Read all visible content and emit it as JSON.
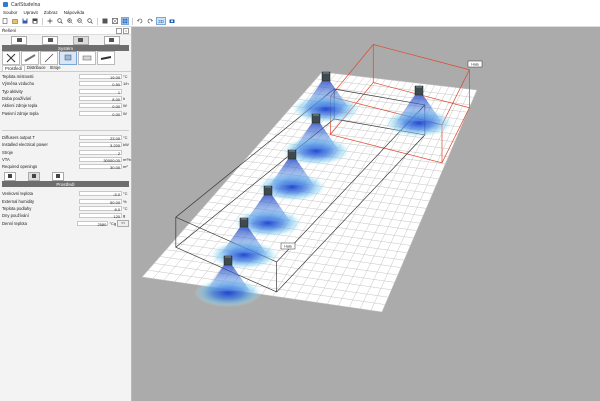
{
  "window": {
    "title": "CarlStudeIna"
  },
  "menu": [
    "Soubor",
    "Upravit",
    "Zobraz",
    "Nápověda"
  ],
  "toolbar": {
    "view_3d_label": "3D"
  },
  "panel": {
    "title": "Řešení",
    "section_system": "Systém",
    "subtabs": [
      "Prostředí",
      "Distribuce",
      "Stroje"
    ],
    "params": [
      {
        "label": "Teplota místnosti",
        "value": "19.00",
        "unit": "°C"
      },
      {
        "label": "Výměna vzduchu",
        "value": "0.50",
        "unit": "1/h"
      },
      {
        "label": "Typ aktivity",
        "value": "1",
        "unit": ""
      },
      {
        "label": "Doba používání",
        "value": "8.00",
        "unit": "h"
      },
      {
        "label": "Aktivní zdroje tepla",
        "value": "0.00",
        "unit": "W"
      },
      {
        "label": "Pasivní zdroje tepla",
        "value": "0.00",
        "unit": "W"
      }
    ],
    "results": [
      {
        "label": "Diffusers output T",
        "value": "23.00",
        "unit": "°C"
      },
      {
        "label": "Installed electrical power",
        "value": "3.200",
        "unit": "kW"
      },
      {
        "label": "Stroje",
        "value": "2",
        "unit": ""
      },
      {
        "label": "VTA",
        "value": "30000.00",
        "unit": "m³/h"
      },
      {
        "label": "Required openings",
        "value": "30.00",
        "unit": "m²"
      }
    ],
    "section_env": "Prostředí",
    "env": [
      {
        "label": "Venkovní teplota",
        "value": "-5.0",
        "unit": "°C"
      },
      {
        "label": "External humidity",
        "value": "50.00",
        "unit": "%"
      },
      {
        "label": "Teplota podlahy",
        "value": "8.0",
        "unit": "°C"
      },
      {
        "label": "Dny používání",
        "value": "120",
        "unit": "g"
      },
      {
        "label": "Denní teplota",
        "value": "2580",
        "unit": "°Cg"
      }
    ],
    "calc_label": "<<"
  },
  "viewport": {
    "zone_tag_red": "Hala",
    "zone_tag_black": "Hala",
    "colors": {
      "grid_line": "#bdbdbd",
      "floor": "#ffffff",
      "zone_red": "#e0452b",
      "zone_black": "#3a3a3a",
      "diffuser": "#1a4fd6",
      "background": "#ababab"
    }
  }
}
